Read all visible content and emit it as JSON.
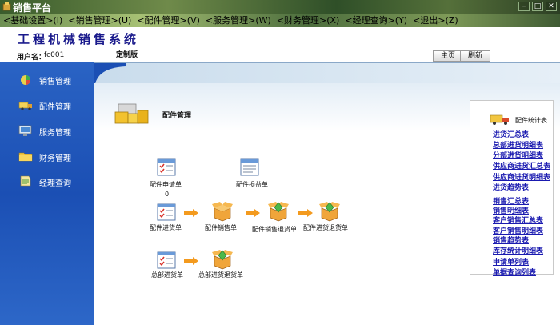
{
  "window": {
    "title": "销售平台"
  },
  "menu": [
    {
      "label": "<基础设置>(I)"
    },
    {
      "label": "<销售管理>(U)"
    },
    {
      "label": "<配件管理>(V)"
    },
    {
      "label": "<服务管理>(W)"
    },
    {
      "label": "<财务管理>(X)"
    },
    {
      "label": "<经理查询>(Y)"
    },
    {
      "label": "<退出>(Z)"
    }
  ],
  "header": {
    "app_title": "工程机械销售系统",
    "user_label": "用户名：",
    "user_value": "fc001",
    "edition": "定制版",
    "home_button": "主页",
    "refresh_button": "刷新"
  },
  "sidebar": {
    "items": [
      {
        "label": "销售管理",
        "icon": "sales-pie-icon"
      },
      {
        "label": "配件管理",
        "icon": "parts-truck-icon"
      },
      {
        "label": "服务管理",
        "icon": "service-monitor-icon"
      },
      {
        "label": "财务管理",
        "icon": "finance-folder-icon"
      },
      {
        "label": "经理查询",
        "icon": "manager-query-icon"
      }
    ]
  },
  "main": {
    "section_title": "配件管理",
    "flow": {
      "apply": "配件申请单",
      "apply_count": "0",
      "damage": "配件损益单",
      "purchase": "配件进货单",
      "sales": "配件销售单",
      "sales_return": "配件销售退货单",
      "purchase_return": "配件进货退货单",
      "hq_purchase": "总部进货单",
      "hq_purchase_return": "总部进货退货单"
    }
  },
  "stats": {
    "title": "配件统计表",
    "links": [
      "进货汇总表",
      "总部进货明细表",
      "分部进货明细表",
      "供应商进货汇总表",
      "供应商进货明细表",
      "进货趋势表",
      "销售汇总表",
      "销售明细表",
      "客户销售汇总表",
      "客户销售明细表",
      "销售趋势表",
      "库存统计明细表",
      "申请单列表",
      "单据查询列表"
    ]
  },
  "colors": {
    "sidebar_blue": "#1b4fb4",
    "link_blue": "#1a1ab0",
    "arrow_orange": "#f39a1e",
    "title_navy": "#1a1a8c"
  }
}
